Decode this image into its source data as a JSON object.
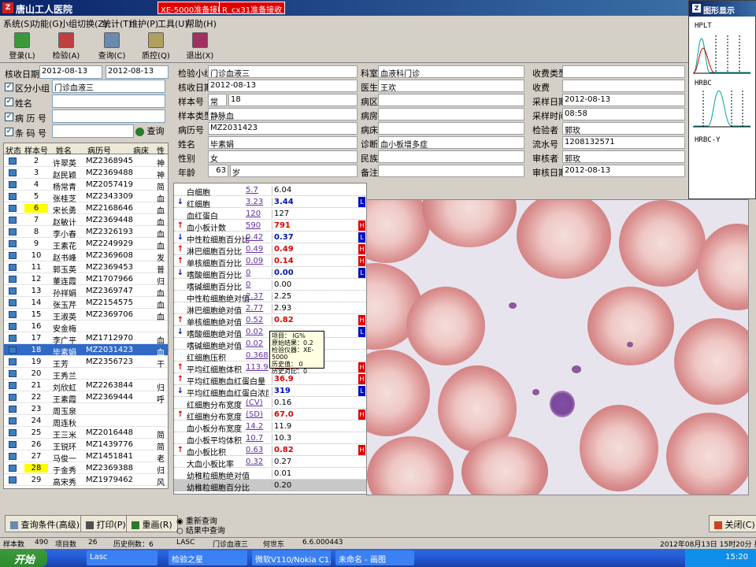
{
  "window": {
    "title": "唐山工人医院",
    "badge1": "XE-5000准备接收",
    "badge2": "R_cx31准备接收"
  },
  "menu": [
    "系统(S)",
    "功能(G)",
    "小组切换(Z)",
    "统计(T)",
    "维护(P)",
    "工具(U)",
    "帮助(H)"
  ],
  "toolbar": [
    {
      "label": "登录(L)"
    },
    {
      "label": "检验(A)"
    },
    {
      "label": "查询(C)"
    },
    {
      "label": "质控(Q)"
    },
    {
      "label": "退出(X)"
    }
  ],
  "filters": {
    "date_label": "核收日期",
    "date_from": "2012-08-13",
    "date_to": "2012-08-13",
    "group_label": "区分小组",
    "group_value": "门诊血液三",
    "name_label": "姓名",
    "record_label": "病 历 号",
    "barcode_label": "条 码 号",
    "query_button": "查询"
  },
  "patient_list": {
    "headers": [
      "状态",
      "样本号",
      "姓名",
      "病历号",
      "病床",
      "性"
    ],
    "rows": [
      {
        "no": "2",
        "name": "许翠英",
        "rec": "MZ2368945",
        "bed": "",
        "x": "神"
      },
      {
        "no": "3",
        "name": "赵民颖",
        "rec": "MZ2369488",
        "bed": "",
        "x": "神"
      },
      {
        "no": "4",
        "name": "杨常青",
        "rec": "MZ2057419",
        "bed": "",
        "x": "简"
      },
      {
        "no": "5",
        "name": "张桂芝",
        "rec": "MZ2343309",
        "bed": "",
        "x": "血"
      },
      {
        "no": "6",
        "name": "宋长勇",
        "rec": "MZ2168646",
        "bed": "",
        "x": "血",
        "yellow": true
      },
      {
        "no": "7",
        "name": "赵敏计",
        "rec": "MZ2369448",
        "bed": "",
        "x": "血"
      },
      {
        "no": "8",
        "name": "李小春",
        "rec": "MZ2326193",
        "bed": "",
        "x": "血"
      },
      {
        "no": "9",
        "name": "王素花",
        "rec": "MZ2249929",
        "bed": "",
        "x": "血"
      },
      {
        "no": "10",
        "name": "赵书峰",
        "rec": "MZ2369608",
        "bed": "",
        "x": "发"
      },
      {
        "no": "11",
        "name": "郭玉英",
        "rec": "MZ2369453",
        "bed": "",
        "x": "普"
      },
      {
        "no": "12",
        "name": "董连霞",
        "rec": "MZ1707966",
        "bed": "",
        "x": "归"
      },
      {
        "no": "13",
        "name": "孙祥娟",
        "rec": "MZ2369747",
        "bed": "",
        "x": "血"
      },
      {
        "no": "14",
        "name": "张玉芹",
        "rec": "MZ2154575",
        "bed": "",
        "x": "血"
      },
      {
        "no": "15",
        "name": "王淑英",
        "rec": "MZ2369706",
        "bed": "",
        "x": "血"
      },
      {
        "no": "16",
        "name": "安金梅",
        "rec": "",
        "bed": "",
        "x": ""
      },
      {
        "no": "17",
        "name": "李广平",
        "rec": "MZ1712970",
        "bed": "",
        "x": "血"
      },
      {
        "no": "18",
        "name": "毕素娟",
        "rec": "MZ2031423",
        "bed": "",
        "x": "血",
        "selected": true
      },
      {
        "no": "19",
        "name": "王芳",
        "rec": "MZ2356723",
        "bed": "",
        "x": "干"
      },
      {
        "no": "20",
        "name": "王秀兰",
        "rec": "",
        "bed": "",
        "x": ""
      },
      {
        "no": "21",
        "name": "刘欣虹",
        "rec": "MZ2263844",
        "bed": "",
        "x": "归"
      },
      {
        "no": "22",
        "name": "王素霞",
        "rec": "MZ2369444",
        "bed": "",
        "x": "呼"
      },
      {
        "no": "23",
        "name": "周玉泉",
        "rec": "",
        "bed": "",
        "x": ""
      },
      {
        "no": "24",
        "name": "周连秋",
        "rec": "",
        "bed": "",
        "x": ""
      },
      {
        "no": "25",
        "name": "王三米",
        "rec": "MZ2016448",
        "bed": "",
        "x": "简"
      },
      {
        "no": "26",
        "name": "王锐环",
        "rec": "MZ1439776",
        "bed": "",
        "x": "简"
      },
      {
        "no": "27",
        "name": "马俊一",
        "rec": "MZ1451841",
        "bed": "",
        "x": "老"
      },
      {
        "no": "28",
        "name": "于金秀",
        "rec": "MZ2369388",
        "bed": "",
        "x": "归",
        "yellow": true
      },
      {
        "no": "29",
        "name": "高宋秀",
        "rec": "MZ1979462",
        "bed": "",
        "x": "风"
      }
    ]
  },
  "info": {
    "group": {
      "label": "检验小组",
      "value": "门诊血液三"
    },
    "dept": {
      "label": "科室",
      "value": "血液科门诊"
    },
    "fee_type": {
      "label": "收费类型",
      "value": ""
    },
    "recv_date": {
      "label": "核收日期",
      "value": "2012-08-13"
    },
    "doctor": {
      "label": "医生",
      "value": "王欢"
    },
    "fee": {
      "label": "收费",
      "value": ""
    },
    "sample_no": {
      "label": "样本号",
      "value1": "常",
      "value2": "18"
    },
    "ward": {
      "label": "病区",
      "value": ""
    },
    "collect_date": {
      "label": "采样日期",
      "value": "2012-08-13"
    },
    "sample_type": {
      "label": "样本类型",
      "value": "静脉血"
    },
    "room": {
      "label": "病房",
      "value": ""
    },
    "collect_time": {
      "label": "采样时间",
      "value": "08:58"
    },
    "record_no": {
      "label": "病历号",
      "value": "MZ2031423"
    },
    "bed": {
      "label": "病床",
      "value": ""
    },
    "tester": {
      "label": "检验者",
      "value": "郭玫"
    },
    "name": {
      "label": "姓名",
      "value": "毕素娟"
    },
    "diagnosis": {
      "label": "诊断",
      "value": "血小板增多症"
    },
    "flow_no": {
      "label": "流水号",
      "value": "1208132571"
    },
    "sex": {
      "label": "性别",
      "value": "女"
    },
    "ethnic": {
      "label": "民族",
      "value": ""
    },
    "reviewer": {
      "label": "审核者",
      "value": "郭玫"
    },
    "age": {
      "label": "年龄",
      "value": "63",
      "unit": "岁"
    },
    "note": {
      "label": "备注",
      "value": ""
    },
    "review_date": {
      "label": "审核日期",
      "value": "2012-08-13"
    }
  },
  "results": [
    {
      "name": "白细胞",
      "ref": "5.7",
      "value": "6.04",
      "arrow": "",
      "flag": ""
    },
    {
      "name": "红细胞",
      "ref": "3.23",
      "value": "3.44",
      "arrow": "↓",
      "flag": "L"
    },
    {
      "name": "血红蛋白",
      "ref": "120",
      "value": "127",
      "arrow": "",
      "flag": ""
    },
    {
      "name": "血小板计数",
      "ref": "590",
      "value": "791",
      "arrow": "↑",
      "flag": "H"
    },
    {
      "name": "中性粒细胞百分比",
      "ref": "0.42",
      "value": "0.37",
      "arrow": "↓",
      "flag": "L"
    },
    {
      "name": "淋巴细胞百分比",
      "ref": "0.49",
      "value": "0.49",
      "arrow": "↑",
      "flag": "H"
    },
    {
      "name": "单核细胞百分比",
      "ref": "0.09",
      "value": "0.14",
      "arrow": "↑",
      "flag": "H"
    },
    {
      "name": "嗜酸细胞百分比",
      "ref": "0",
      "value": "0.00",
      "arrow": "↓",
      "flag": "L"
    },
    {
      "name": "嗜碱细胞百分比",
      "ref": "0",
      "value": "0.00",
      "arrow": "",
      "flag": ""
    },
    {
      "name": "中性粒细胞绝对值",
      "ref": "2.37",
      "value": "2.25",
      "arrow": "",
      "flag": ""
    },
    {
      "name": "淋巴细胞绝对值",
      "ref": "2.77",
      "value": "2.93",
      "arrow": "",
      "flag": ""
    },
    {
      "name": "单核细胞绝对值",
      "ref": "0.52",
      "value": "0.82",
      "arrow": "↑",
      "flag": "H"
    },
    {
      "name": "嗜酸细胞绝对值",
      "ref": "0.02",
      "value": "",
      "arrow": "↓",
      "flag": "L"
    },
    {
      "name": "嗜碱细胞绝对值",
      "ref": "0.02",
      "value": "",
      "arrow": "",
      "flag": ""
    },
    {
      "name": "红细胞压积",
      "ref": "0.368",
      "value": "",
      "arrow": "",
      "flag": ""
    },
    {
      "name": "平均红细胞体积",
      "ref": "113.9",
      "value": "113.4",
      "arrow": "↑",
      "flag": "H"
    },
    {
      "name": "平均红细胞血红蛋白量",
      "ref": "",
      "value": "36.9",
      "arrow": "↑",
      "flag": "H"
    },
    {
      "name": "平均红细胞血红蛋白浓度",
      "ref": "",
      "value": "319",
      "arrow": "↓",
      "flag": "L"
    },
    {
      "name": "红细胞分布宽度",
      "ref": "(CV)",
      "value": "0.16",
      "arrow": "",
      "flag": ""
    },
    {
      "name": "红细胞分布宽度",
      "ref": "(SD)",
      "value": "67.0",
      "arrow": "↑",
      "flag": "H"
    },
    {
      "name": "血小板分布宽度",
      "ref": "14.2",
      "value": "11.9",
      "arrow": "",
      "flag": ""
    },
    {
      "name": "血小板平均体积",
      "ref": "10.7",
      "value": "10.3",
      "arrow": "",
      "flag": ""
    },
    {
      "name": "血小板比积",
      "ref": "0.63",
      "value": "0.82",
      "arrow": "↑",
      "flag": "H"
    },
    {
      "name": "大血小板比率",
      "ref": "0.32",
      "value": "0.27",
      "arrow": "",
      "flag": ""
    },
    {
      "name": "幼稚粒细胞绝对值",
      "ref": "",
      "value": "0.01",
      "arrow": "",
      "flag": ""
    },
    {
      "name": "幼稚粒细胞百分比",
      "ref": "",
      "value": "0.20",
      "arrow": "",
      "flag": ""
    }
  ],
  "tooltip": {
    "line1": "项目：",
    "line1b": "IG%",
    "line2": "原始结果：0.2",
    "line3": "检验仪器：XE-5000",
    "line4": "历史值： 0",
    "line5": "历史对比：0"
  },
  "histograms": {
    "title": "图形显示",
    "h1": "HPLT",
    "h2": "HRBC",
    "h3": "HRBC-Y"
  },
  "bottom": {
    "query_cond": "查询条件(高级)",
    "print": "打印(P)",
    "reset": "重画(R)",
    "radio1": "重新查询",
    "radio2": "结果中查询",
    "close": "关闭(C)"
  },
  "status": {
    "count_label": "样本数",
    "count": "490",
    "items_label": "项目数",
    "items": "26",
    "hist_label": "历史例数：6",
    "lasc": "LASC",
    "group": "门诊血液三",
    "user": "何世东",
    "version": "6.6.000443",
    "datetime": "2012年08月13日 15时20分 星期一"
  },
  "taskbar": {
    "start": "开始",
    "tasks": [
      "Lasc",
      "检验之星",
      "微软V110/Nokia C1...",
      "未命名 - 画图"
    ],
    "time": "15:20"
  },
  "colors": {
    "high": "#e00000",
    "low": "#0010c0",
    "select": "#316ac5"
  }
}
